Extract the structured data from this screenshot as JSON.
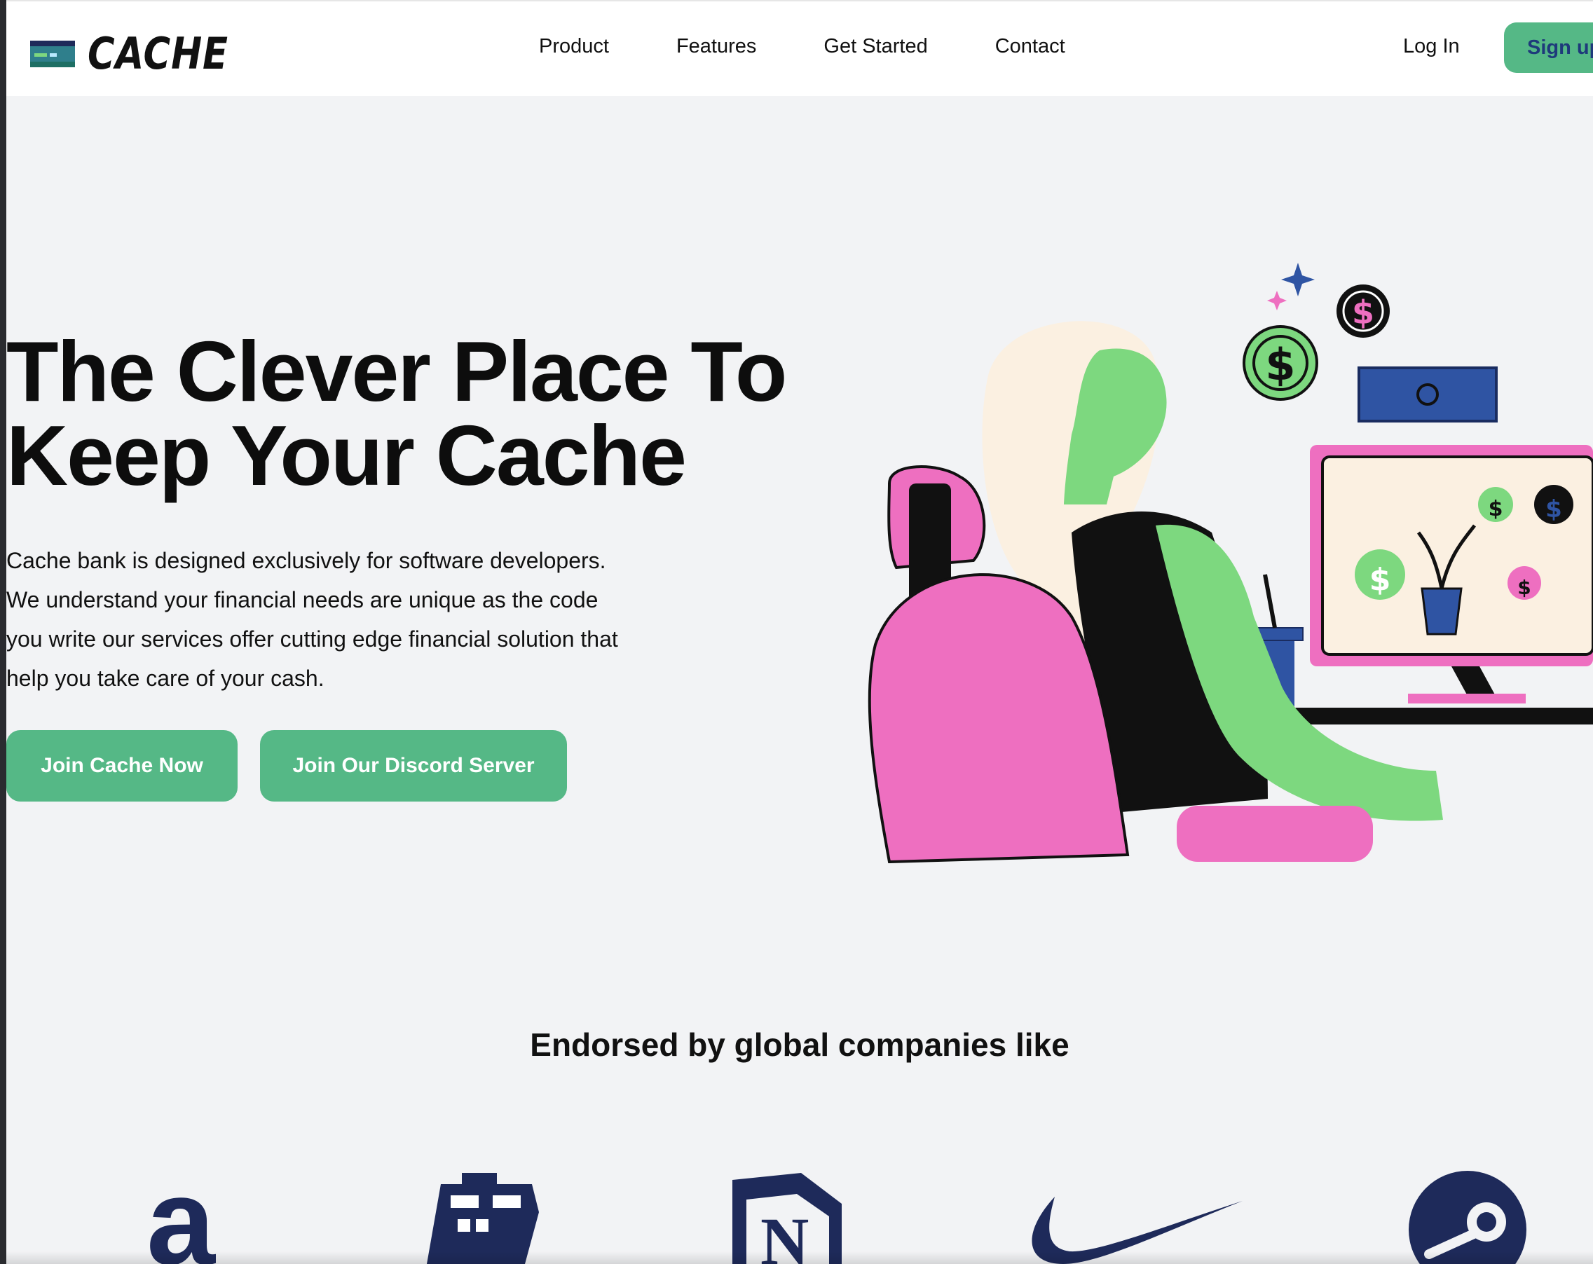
{
  "header": {
    "brand_name": "CACHE",
    "nav": [
      "Product",
      "Features",
      "Get Started",
      "Contact"
    ],
    "login_label": "Log In",
    "signup_label": "Sign up"
  },
  "hero": {
    "title_line1": "The Clever Place To",
    "title_line2": "Keep Your Cache",
    "description": "Cache bank is designed exclusively for software developers. We understand your financial needs are unique as the code you write our services offer cutting edge financial solution that help you take care of your cash.",
    "primary_button": "Join Cache Now",
    "secondary_button": "Join Our Discord Server"
  },
  "endorsements": {
    "heading": "Endorsed by global companies like",
    "logos": [
      "amazon-logo",
      "minecraft-logo",
      "notion-logo",
      "nike-logo",
      "steam-logo"
    ]
  },
  "colors": {
    "accent_green": "#55b886",
    "navy": "#1e2a5a",
    "pink": "#ee6fc0",
    "skin_green": "#7dd87f",
    "cream": "#fbf0e1",
    "background": "#f2f3f5"
  }
}
